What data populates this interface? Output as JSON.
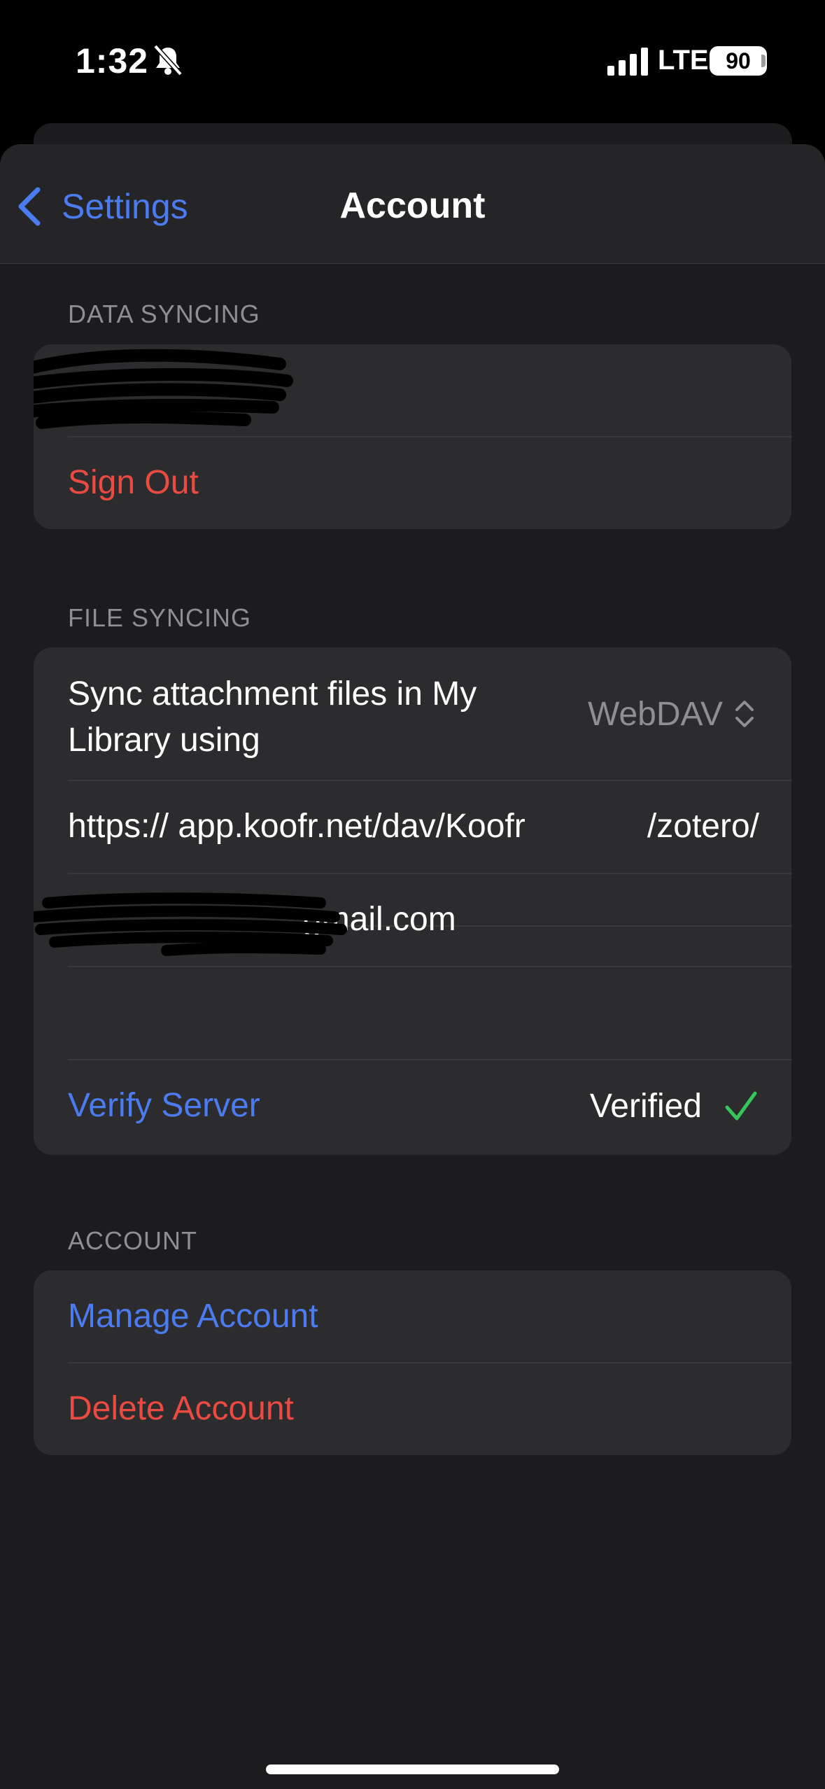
{
  "status_bar": {
    "time": "1:32",
    "network": "LTE",
    "battery": "90",
    "icons": [
      "bell-slash-icon",
      "signal-icon",
      "battery-icon"
    ]
  },
  "navbar": {
    "back_label": "Settings",
    "title": "Account"
  },
  "data_syncing": {
    "header": "DATA SYNCING",
    "sign_out": "Sign Out"
  },
  "file_syncing": {
    "header": "FILE SYNCING",
    "sync_label": "Sync attachment files in My Library using",
    "sync_value": "WebDAV",
    "url_left": "https:// app.koofr.net/dav/Koofr",
    "url_right": "/zotero/",
    "username_visible": "gmail.com",
    "password": "",
    "verify_label": "Verify Server",
    "verify_status": "Verified"
  },
  "account": {
    "header": "ACCOUNT",
    "manage": "Manage Account",
    "delete": "Delete Account"
  },
  "colors": {
    "accent_blue": "#4a7cf0",
    "destructive_red": "#eb4a41",
    "success_green": "#34c759"
  }
}
